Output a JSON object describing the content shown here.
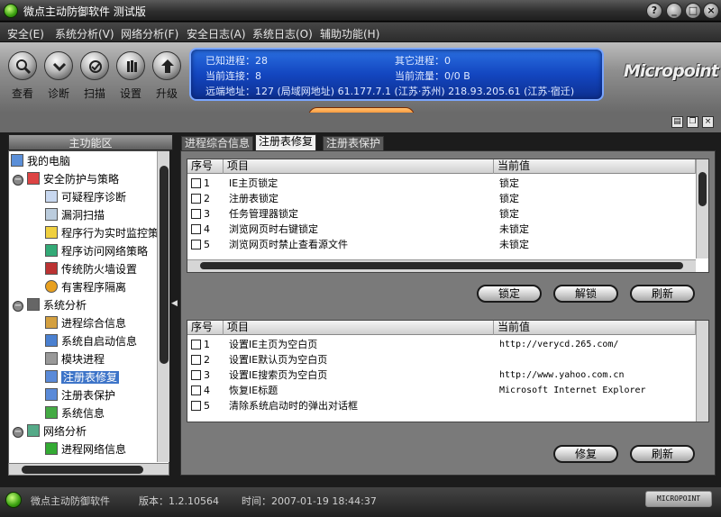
{
  "window": {
    "title": "微点主动防御软件  测试版",
    "buttons": [
      "?",
      "_",
      "□",
      "×"
    ]
  },
  "menu": [
    "安全(E)",
    "系统分析(V)",
    "网络分析(F)",
    "安全日志(A)",
    "系统日志(O)",
    "辅助功能(H)"
  ],
  "toolbar": {
    "tools": [
      {
        "label": "查看",
        "icon": "magnifier-icon"
      },
      {
        "label": "诊断",
        "icon": "chevron-down-icon"
      },
      {
        "label": "扫描",
        "icon": "scan-icon"
      },
      {
        "label": "设置",
        "icon": "hand-icon"
      },
      {
        "label": "升级",
        "icon": "upgrade-icon"
      }
    ]
  },
  "info": {
    "known_processes": "已知进程：28",
    "other_processes": "其它进程：0",
    "current_connections": "当前连接：8",
    "current_traffic": "当前流量：0/0 B",
    "remote_addresses": "远端地址：127 (局域网地址)   61.177.7.1 (江苏·苏州)   218.93.205.61 (江苏·宿迁)"
  },
  "logo": "Micropoint",
  "sidebar": {
    "header": "主功能区",
    "root": "我的电脑",
    "groups": [
      {
        "label": "安全防护与策略",
        "items": [
          "可疑程序诊断",
          "漏洞扫描",
          "程序行为实时监控策略",
          "程序访问网络策略",
          "传统防火墙设置",
          "有害程序隔离"
        ]
      },
      {
        "label": "系统分析",
        "items": [
          "进程综合信息",
          "系统自启动信息",
          "模块进程",
          "注册表修复",
          "注册表保护",
          "系统信息"
        ]
      },
      {
        "label": "网络分析",
        "items": [
          "进程网络信息"
        ]
      }
    ],
    "selected": "注册表修复"
  },
  "tabs": [
    "进程综合信息",
    "注册表修复",
    "注册表保护"
  ],
  "active_tab": "注册表修复",
  "grid1": {
    "columns": [
      "序号",
      "项目",
      "当前值"
    ],
    "rows": [
      {
        "no": "1",
        "item": "IE主页锁定",
        "value": "锁定"
      },
      {
        "no": "2",
        "item": "注册表锁定",
        "value": "锁定"
      },
      {
        "no": "3",
        "item": "任务管理器锁定",
        "value": "锁定"
      },
      {
        "no": "4",
        "item": "浏览网页时右键锁定",
        "value": "未锁定"
      },
      {
        "no": "5",
        "item": "浏览网页时禁止查看源文件",
        "value": "未锁定"
      }
    ],
    "buttons": [
      "锁定",
      "解锁",
      "刷新"
    ]
  },
  "grid2": {
    "columns": [
      "序号",
      "项目",
      "当前值"
    ],
    "rows": [
      {
        "no": "1",
        "item": "设置IE主页为空白页",
        "value": "http://verycd.265.com/"
      },
      {
        "no": "2",
        "item": "设置IE默认页为空白页",
        "value": ""
      },
      {
        "no": "3",
        "item": "设置IE搜索页为空白页",
        "value": "http://www.yahoo.com.cn"
      },
      {
        "no": "4",
        "item": "恢复IE标题",
        "value": "Microsoft Internet Explorer"
      },
      {
        "no": "5",
        "item": "清除系统启动时的弹出对话框",
        "value": ""
      }
    ],
    "buttons": [
      "修复",
      "刷新"
    ]
  },
  "status": {
    "app_name": "微点主动防御软件",
    "version": "版本：1.2.10564",
    "time": "时间：2007-01-19 18:44:37",
    "logo": "MICROPOINT"
  },
  "colors": {
    "info_panel": "#1346c0",
    "accent_orange": "#ff7a10",
    "selection": "#3d74c8"
  }
}
